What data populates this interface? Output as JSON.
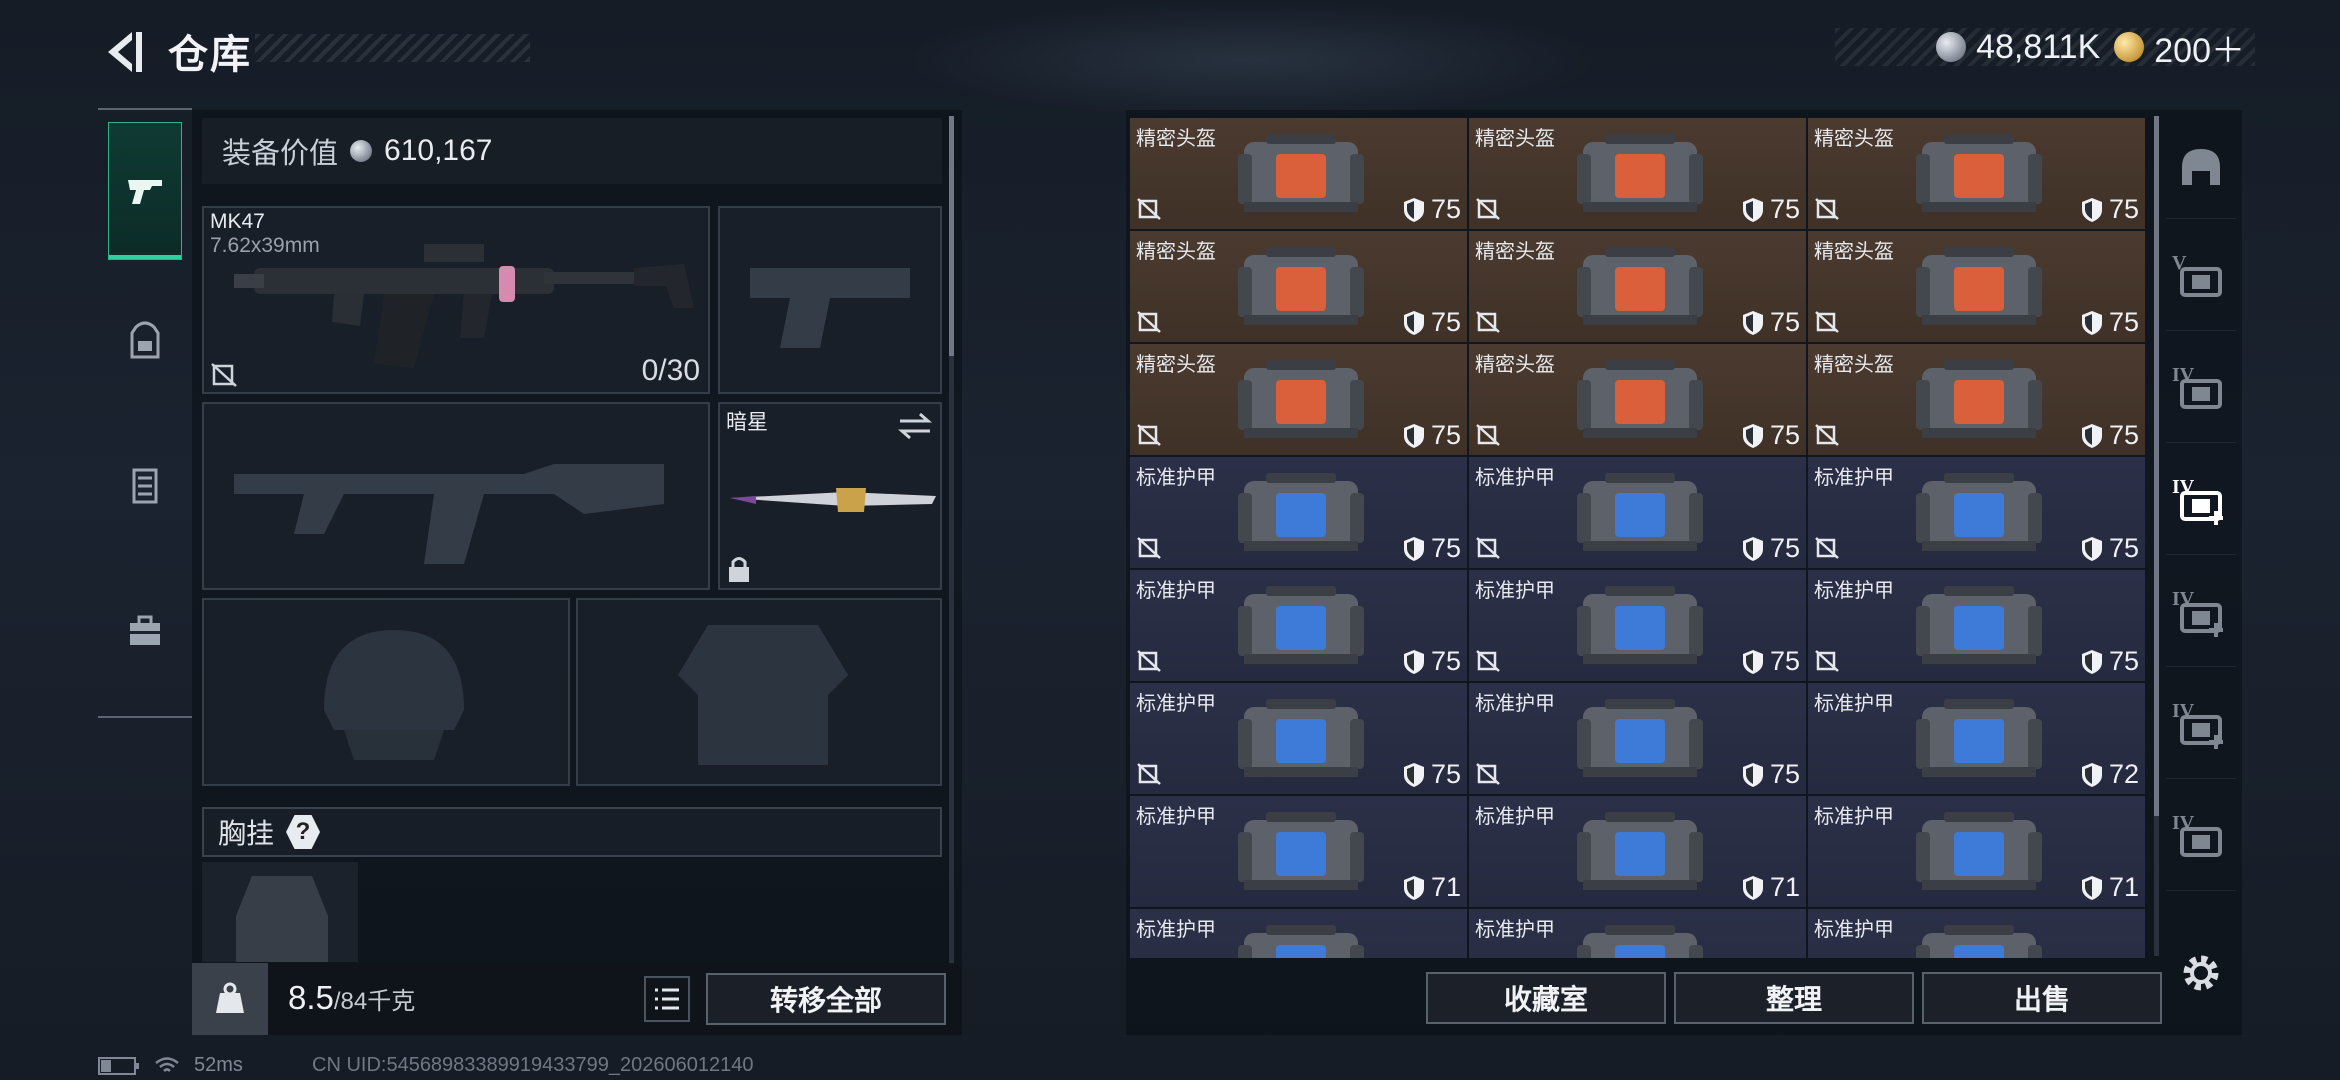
{
  "header": {
    "title": "仓库",
    "silver": "48,811K",
    "gold": "200＋"
  },
  "tabs": [
    "firearm-icon",
    "backpack-icon",
    "vest-icon",
    "toolbox-icon"
  ],
  "loadout": {
    "value_label": "装备价值",
    "value": "610,167",
    "primary": {
      "name": "MK47",
      "caliber": "7.62x39mm",
      "ammo": "0/30"
    },
    "melee": {
      "name": "暗星"
    },
    "chest_label": "胸挂",
    "chest_help": "?"
  },
  "footer_left": {
    "weight": "8.5",
    "capacity": "/84千克",
    "transfer": "转移全部"
  },
  "stash": {
    "items": [
      {
        "name": "精密头盔",
        "dur": "75",
        "type": "helmet",
        "locked": true
      },
      {
        "name": "精密头盔",
        "dur": "75",
        "type": "helmet",
        "locked": true
      },
      {
        "name": "精密头盔",
        "dur": "75",
        "type": "helmet",
        "locked": true
      },
      {
        "name": "精密头盔",
        "dur": "75",
        "type": "helmet",
        "locked": true
      },
      {
        "name": "精密头盔",
        "dur": "75",
        "type": "helmet",
        "locked": true
      },
      {
        "name": "精密头盔",
        "dur": "75",
        "type": "helmet",
        "locked": true
      },
      {
        "name": "精密头盔",
        "dur": "75",
        "type": "helmet",
        "locked": true
      },
      {
        "name": "精密头盔",
        "dur": "75",
        "type": "helmet",
        "locked": true
      },
      {
        "name": "精密头盔",
        "dur": "75",
        "type": "helmet",
        "locked": true
      },
      {
        "name": "标准护甲",
        "dur": "75",
        "type": "armor",
        "locked": true
      },
      {
        "name": "标准护甲",
        "dur": "75",
        "type": "armor",
        "locked": true
      },
      {
        "name": "标准护甲",
        "dur": "75",
        "type": "armor",
        "locked": true
      },
      {
        "name": "标准护甲",
        "dur": "75",
        "type": "armor",
        "locked": true
      },
      {
        "name": "标准护甲",
        "dur": "75",
        "type": "armor",
        "locked": true
      },
      {
        "name": "标准护甲",
        "dur": "75",
        "type": "armor",
        "locked": true
      },
      {
        "name": "标准护甲",
        "dur": "75",
        "type": "armor",
        "locked": true
      },
      {
        "name": "标准护甲",
        "dur": "75",
        "type": "armor",
        "locked": true
      },
      {
        "name": "标准护甲",
        "dur": "72",
        "type": "armor",
        "locked": false
      },
      {
        "name": "标准护甲",
        "dur": "71",
        "type": "armor",
        "locked": false
      },
      {
        "name": "标准护甲",
        "dur": "71",
        "type": "armor",
        "locked": false
      },
      {
        "name": "标准护甲",
        "dur": "71",
        "type": "armor",
        "locked": false
      },
      {
        "name": "标准护甲",
        "dur": "",
        "type": "armor",
        "locked": false
      },
      {
        "name": "标准护甲",
        "dur": "",
        "type": "armor",
        "locked": false
      },
      {
        "name": "标准护甲",
        "dur": "",
        "type": "armor",
        "locked": false
      }
    ],
    "buttons": {
      "collection": "收藏室",
      "organize": "整理",
      "sell": "出售"
    }
  },
  "siderail": [
    {
      "icon": "helmet-icon",
      "rank": ""
    },
    {
      "icon": "armor-tier-v-icon",
      "rank": "V"
    },
    {
      "icon": "armor-tier-iv-icon",
      "rank": "IV"
    },
    {
      "icon": "medkit-tier-iv-icon",
      "rank": "IV"
    },
    {
      "icon": "medkit-tier-iv-icon",
      "rank": "IV"
    },
    {
      "icon": "medkit-tier-iv-icon",
      "rank": "IV"
    },
    {
      "icon": "ammo-tier-iv-icon",
      "rank": "IV"
    }
  ],
  "status": {
    "ping": "52ms",
    "uid": "CN UID:54568983389919433799_202606012140"
  },
  "colors": {
    "helmet_bg": "#4b3a2f",
    "armor_bg": "#2b3048",
    "accent": "#2fd0a0"
  }
}
